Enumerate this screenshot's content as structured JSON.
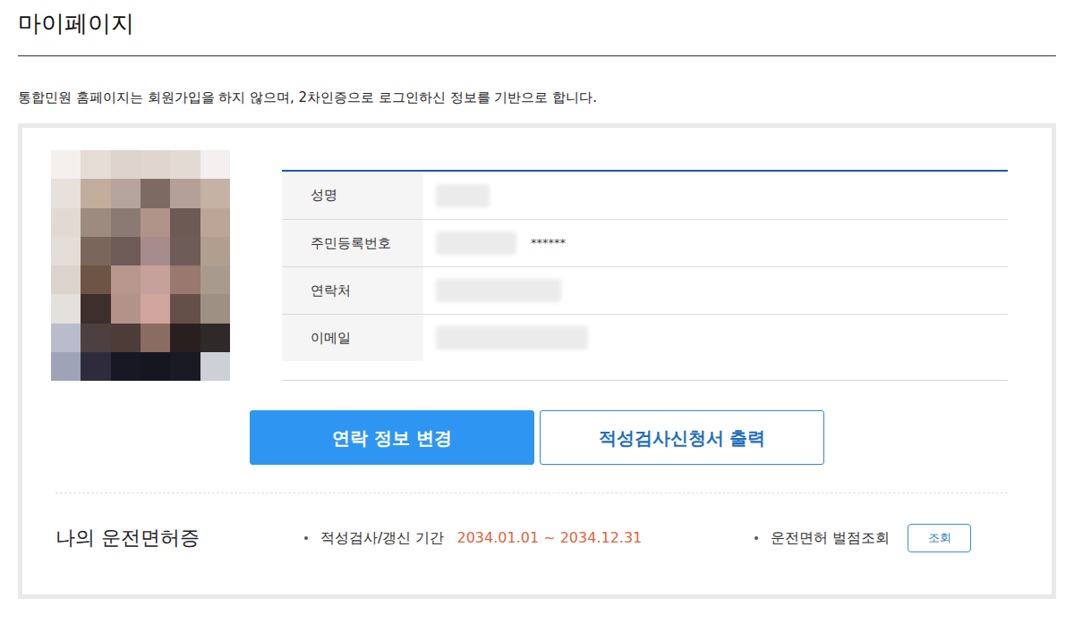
{
  "page": {
    "title": "마이페이지",
    "notice": "통합민원 홈페이지는 회원가입을 하지 않으며, 2차인증으로 로그인하신 정보를 기반으로 합니다."
  },
  "profile": {
    "fields": [
      {
        "label": "성명",
        "visible_text": ""
      },
      {
        "label": "주민등록번호",
        "visible_text": "******"
      },
      {
        "label": "연락처",
        "visible_text": ""
      },
      {
        "label": "이메일",
        "visible_text": ""
      }
    ]
  },
  "buttons": [
    {
      "label": "연락 정보 변경",
      "kind": "filled"
    },
    {
      "label": "적성검사신청서 출력",
      "kind": "outline"
    }
  ],
  "license": {
    "title": "나의 운전면허증",
    "renewal_label": "적성검사/갱신 기간",
    "renewal_period": "2034.01.01 ~ 2034.12.31",
    "penalty_label": "운전면허 벌점조회",
    "penalty_button": "조회"
  }
}
